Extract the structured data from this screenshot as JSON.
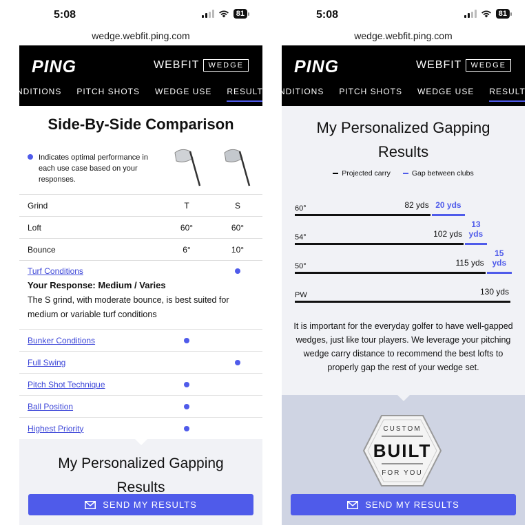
{
  "status": {
    "time": "5:08",
    "battery": "81"
  },
  "url": "wedge.webfit.ping.com",
  "header": {
    "logo": "PING",
    "webfit": "WEBFIT",
    "wedge": "WEDGE",
    "tabs": [
      "NDITIONS",
      "PITCH SHOTS",
      "WEDGE USE",
      "RESULTS"
    ],
    "active_tab": "RESULTS"
  },
  "left": {
    "title": "Side-By-Side Comparison",
    "legend_note": "Indicates optimal performance in each use case based on your responses.",
    "specs": [
      {
        "label": "Grind",
        "t": "T",
        "s": "S"
      },
      {
        "label": "Loft",
        "t": "60°",
        "s": "60°"
      },
      {
        "label": "Bounce",
        "t": "6°",
        "s": "10°"
      }
    ],
    "expanded": {
      "label": "Turf Conditions",
      "response": "Your Response: Medium / Varies",
      "desc": "The S grind, with moderate bounce, is best suited for medium or variable turf conditions"
    },
    "use_cases": [
      {
        "label": "Bunker Conditions",
        "optimal": "T"
      },
      {
        "label": "Full Swing",
        "optimal": "S"
      },
      {
        "label": "Pitch Shot Technique",
        "optimal": "T"
      },
      {
        "label": "Ball Position",
        "optimal": "T"
      },
      {
        "label": "Highest Priority",
        "optimal": "T"
      }
    ],
    "gap_title_1": "My Personalized Gapping",
    "gap_title_2": "Results"
  },
  "right": {
    "gap_title_1": "My Personalized Gapping",
    "gap_title_2": "Results",
    "legend_carry": "Projected carry",
    "legend_gap": "Gap between clubs",
    "bars": [
      {
        "club": "60°",
        "carry": 82,
        "carry_label": "82 yds",
        "gap": 20,
        "gap_label": "20 yds"
      },
      {
        "club": "54°",
        "carry": 102,
        "carry_label": "102 yds",
        "gap": 13,
        "gap_label": "13 yds"
      },
      {
        "club": "50°",
        "carry": 115,
        "carry_label": "115 yds",
        "gap": 15,
        "gap_label": "15 yds"
      },
      {
        "club": "PW",
        "carry": 130,
        "carry_label": "130 yds",
        "gap": 0,
        "gap_label": ""
      }
    ],
    "paragraph": "It is important for the everyday golfer to have well-gapped wedges, just like tour players. We leverage your pitching wedge carry distance to recommend the best lofts to properly gap the rest of your wedge set.",
    "badge": {
      "top": "CUSTOM",
      "main": "BUILT",
      "bottom": "FOR YOU"
    }
  },
  "send_label": "SEND MY RESULTS",
  "colors": {
    "accent": "#4f5bea",
    "header": "#000000"
  }
}
